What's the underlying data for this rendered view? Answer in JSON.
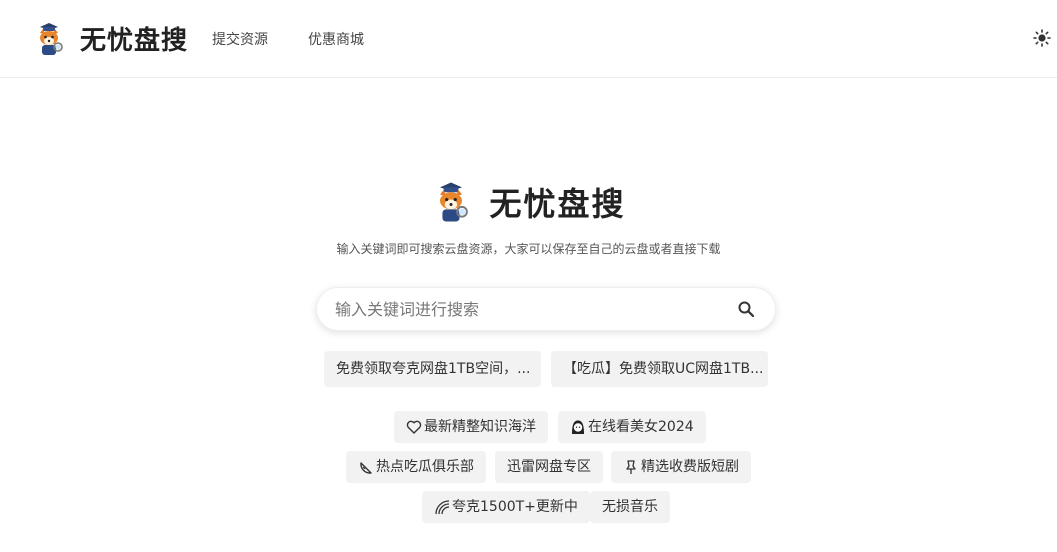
{
  "header": {
    "brand_name": "无忧盘搜",
    "nav": {
      "submit_label": "提交资源",
      "deals_label": "优惠商城"
    }
  },
  "hero": {
    "title": "无忧盘搜",
    "subtitle": "输入关键词即可搜索云盘资源，大家可以保存至自己的云盘或者直接下载"
  },
  "search": {
    "placeholder": "输入关键词进行搜索",
    "value": ""
  },
  "promos": [
    {
      "label": "免费领取夸克网盘1TB空间，..."
    },
    {
      "label": "【吃瓜】免费领取UC网盘1TB..."
    }
  ],
  "tags": [
    {
      "label": "最新精整知识海洋",
      "icon": "heart-icon"
    },
    {
      "label": "在线看美女2024",
      "icon": "girl-icon"
    },
    {
      "label": "热点吃瓜俱乐部",
      "icon": "melon-icon"
    },
    {
      "label": "迅雷网盘专区",
      "icon": ""
    },
    {
      "label": "精选收费版短剧",
      "icon": "pin-icon"
    },
    {
      "label": "夸克1500T+更新中",
      "icon": "rainbow-icon"
    },
    {
      "label": "无损音乐",
      "icon": ""
    }
  ]
}
